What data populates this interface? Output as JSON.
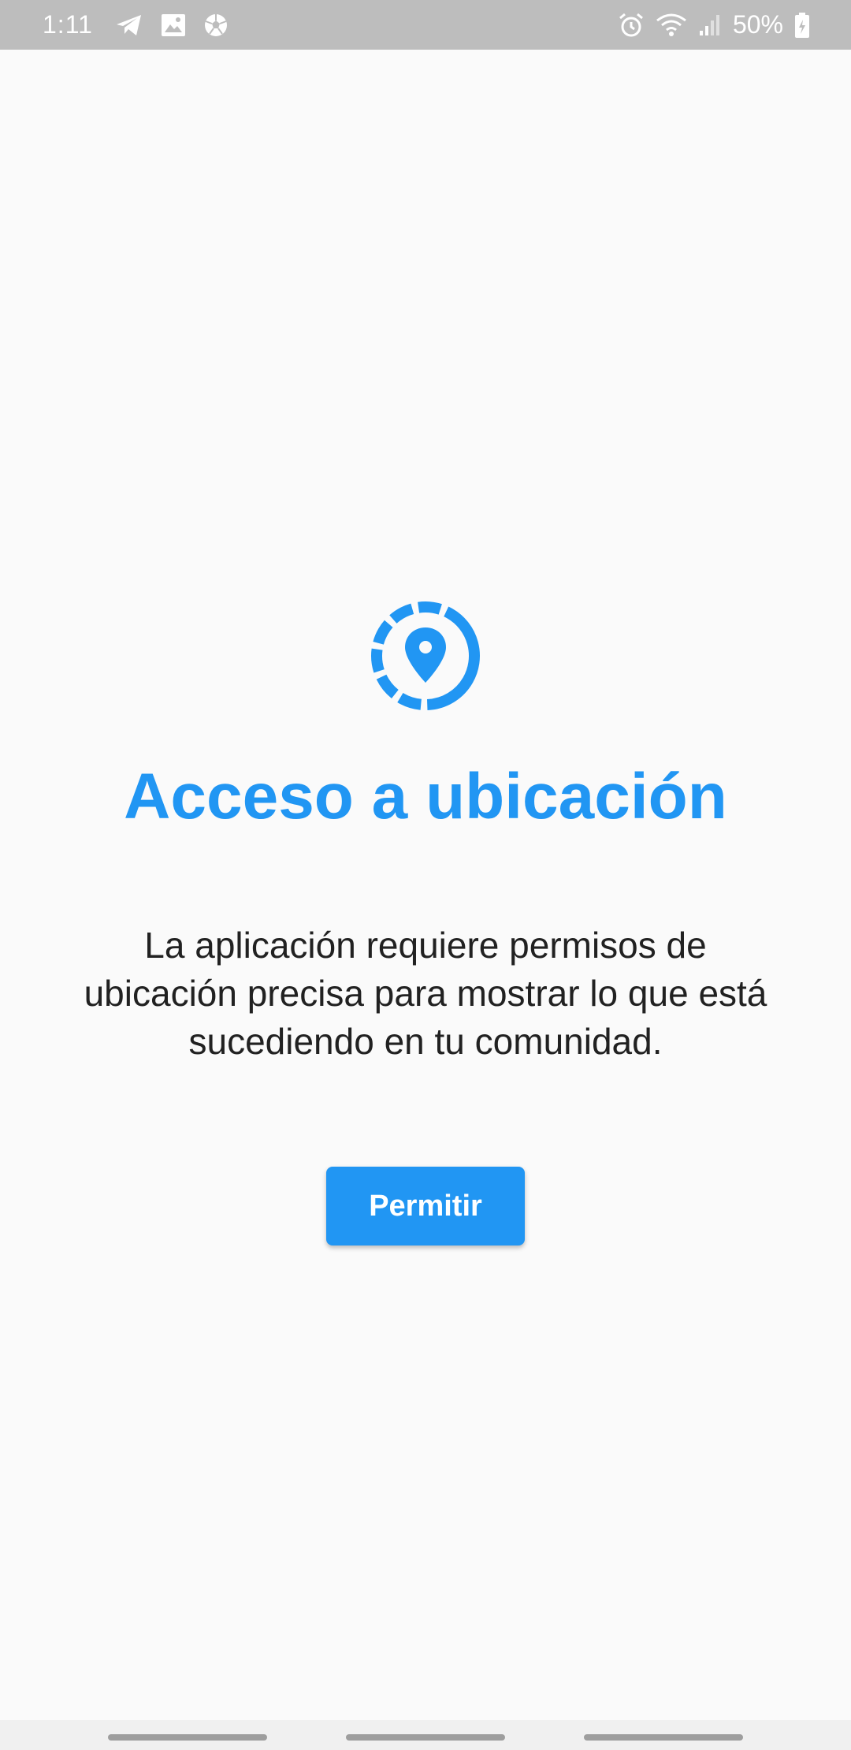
{
  "status_bar": {
    "time": "1:11",
    "battery": "50%",
    "left_icons": [
      "telegram-icon",
      "image-icon",
      "soccer-ball-icon"
    ],
    "right_icons": [
      "alarm-icon",
      "wifi-icon",
      "signal-icon",
      "battery-icon"
    ]
  },
  "permission_screen": {
    "icon": "location-pin-icon",
    "title": "Acceso a ubicación",
    "description": "La aplicación requiere permisos de ubicación precisa para mostrar lo que está sucediendo en tu comunidad.",
    "allow_label": "Permitir"
  },
  "colors": {
    "accent": "#2196f3",
    "background": "#fafafa",
    "status_bar": "#bdbdbd",
    "text": "#212121"
  }
}
